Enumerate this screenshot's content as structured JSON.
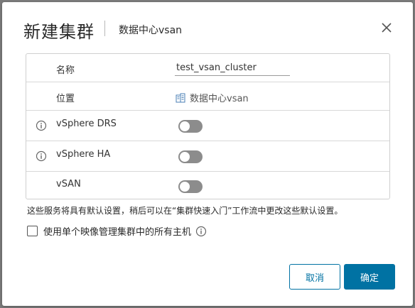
{
  "dialog": {
    "title": "新建集群",
    "subtitle": "数据中心vsan",
    "close_icon": "close-icon"
  },
  "form": {
    "name_label": "名称",
    "name_value": "test_vsan_cluster",
    "location_label": "位置",
    "location_value": "数据中心vsan",
    "location_icon": "datacenter-icon",
    "drs_label": "vSphere DRS",
    "drs_enabled": false,
    "ha_label": "vSphere HA",
    "ha_enabled": false,
    "vsan_label": "vSAN",
    "vsan_enabled": false,
    "info_icon": "info-icon"
  },
  "note": "这些服务将具有默认设置，稍后可以在“集群快速入门”工作流中更改这些默认设置。",
  "image_management": {
    "label": "使用单个映像管理集群中的所有主机",
    "checked": false
  },
  "buttons": {
    "cancel": "取消",
    "ok": "确定"
  },
  "colors": {
    "primary": "#0072a3",
    "toggle_off": "#8c8c8c"
  }
}
